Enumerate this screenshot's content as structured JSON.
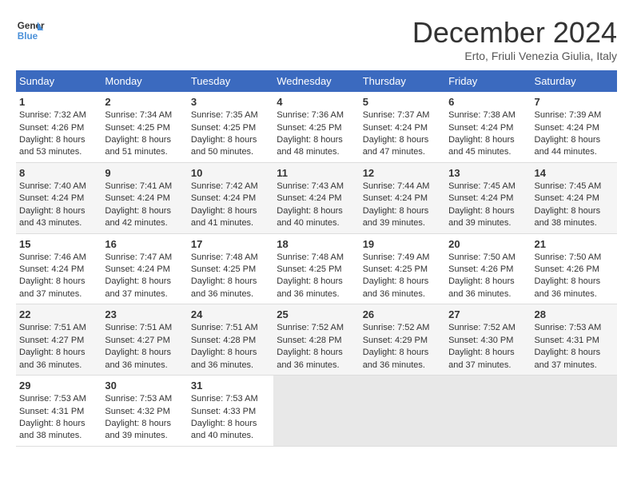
{
  "header": {
    "logo_line1": "General",
    "logo_line2": "Blue",
    "month": "December 2024",
    "location": "Erto, Friuli Venezia Giulia, Italy"
  },
  "days_of_week": [
    "Sunday",
    "Monday",
    "Tuesday",
    "Wednesday",
    "Thursday",
    "Friday",
    "Saturday"
  ],
  "weeks": [
    [
      {
        "day": "1",
        "sunrise": "7:32 AM",
        "sunset": "4:26 PM",
        "daylight": "8 hours and 53 minutes."
      },
      {
        "day": "2",
        "sunrise": "7:34 AM",
        "sunset": "4:25 PM",
        "daylight": "8 hours and 51 minutes."
      },
      {
        "day": "3",
        "sunrise": "7:35 AM",
        "sunset": "4:25 PM",
        "daylight": "8 hours and 50 minutes."
      },
      {
        "day": "4",
        "sunrise": "7:36 AM",
        "sunset": "4:25 PM",
        "daylight": "8 hours and 48 minutes."
      },
      {
        "day": "5",
        "sunrise": "7:37 AM",
        "sunset": "4:24 PM",
        "daylight": "8 hours and 47 minutes."
      },
      {
        "day": "6",
        "sunrise": "7:38 AM",
        "sunset": "4:24 PM",
        "daylight": "8 hours and 45 minutes."
      },
      {
        "day": "7",
        "sunrise": "7:39 AM",
        "sunset": "4:24 PM",
        "daylight": "8 hours and 44 minutes."
      }
    ],
    [
      {
        "day": "8",
        "sunrise": "7:40 AM",
        "sunset": "4:24 PM",
        "daylight": "8 hours and 43 minutes."
      },
      {
        "day": "9",
        "sunrise": "7:41 AM",
        "sunset": "4:24 PM",
        "daylight": "8 hours and 42 minutes."
      },
      {
        "day": "10",
        "sunrise": "7:42 AM",
        "sunset": "4:24 PM",
        "daylight": "8 hours and 41 minutes."
      },
      {
        "day": "11",
        "sunrise": "7:43 AM",
        "sunset": "4:24 PM",
        "daylight": "8 hours and 40 minutes."
      },
      {
        "day": "12",
        "sunrise": "7:44 AM",
        "sunset": "4:24 PM",
        "daylight": "8 hours and 39 minutes."
      },
      {
        "day": "13",
        "sunrise": "7:45 AM",
        "sunset": "4:24 PM",
        "daylight": "8 hours and 39 minutes."
      },
      {
        "day": "14",
        "sunrise": "7:45 AM",
        "sunset": "4:24 PM",
        "daylight": "8 hours and 38 minutes."
      }
    ],
    [
      {
        "day": "15",
        "sunrise": "7:46 AM",
        "sunset": "4:24 PM",
        "daylight": "8 hours and 37 minutes."
      },
      {
        "day": "16",
        "sunrise": "7:47 AM",
        "sunset": "4:24 PM",
        "daylight": "8 hours and 37 minutes."
      },
      {
        "day": "17",
        "sunrise": "7:48 AM",
        "sunset": "4:25 PM",
        "daylight": "8 hours and 36 minutes."
      },
      {
        "day": "18",
        "sunrise": "7:48 AM",
        "sunset": "4:25 PM",
        "daylight": "8 hours and 36 minutes."
      },
      {
        "day": "19",
        "sunrise": "7:49 AM",
        "sunset": "4:25 PM",
        "daylight": "8 hours and 36 minutes."
      },
      {
        "day": "20",
        "sunrise": "7:50 AM",
        "sunset": "4:26 PM",
        "daylight": "8 hours and 36 minutes."
      },
      {
        "day": "21",
        "sunrise": "7:50 AM",
        "sunset": "4:26 PM",
        "daylight": "8 hours and 36 minutes."
      }
    ],
    [
      {
        "day": "22",
        "sunrise": "7:51 AM",
        "sunset": "4:27 PM",
        "daylight": "8 hours and 36 minutes."
      },
      {
        "day": "23",
        "sunrise": "7:51 AM",
        "sunset": "4:27 PM",
        "daylight": "8 hours and 36 minutes."
      },
      {
        "day": "24",
        "sunrise": "7:51 AM",
        "sunset": "4:28 PM",
        "daylight": "8 hours and 36 minutes."
      },
      {
        "day": "25",
        "sunrise": "7:52 AM",
        "sunset": "4:28 PM",
        "daylight": "8 hours and 36 minutes."
      },
      {
        "day": "26",
        "sunrise": "7:52 AM",
        "sunset": "4:29 PM",
        "daylight": "8 hours and 36 minutes."
      },
      {
        "day": "27",
        "sunrise": "7:52 AM",
        "sunset": "4:30 PM",
        "daylight": "8 hours and 37 minutes."
      },
      {
        "day": "28",
        "sunrise": "7:53 AM",
        "sunset": "4:31 PM",
        "daylight": "8 hours and 37 minutes."
      }
    ],
    [
      {
        "day": "29",
        "sunrise": "7:53 AM",
        "sunset": "4:31 PM",
        "daylight": "8 hours and 38 minutes."
      },
      {
        "day": "30",
        "sunrise": "7:53 AM",
        "sunset": "4:32 PM",
        "daylight": "8 hours and 39 minutes."
      },
      {
        "day": "31",
        "sunrise": "7:53 AM",
        "sunset": "4:33 PM",
        "daylight": "8 hours and 40 minutes."
      },
      null,
      null,
      null,
      null
    ]
  ],
  "labels": {
    "sunrise": "Sunrise:",
    "sunset": "Sunset:",
    "daylight": "Daylight:"
  }
}
